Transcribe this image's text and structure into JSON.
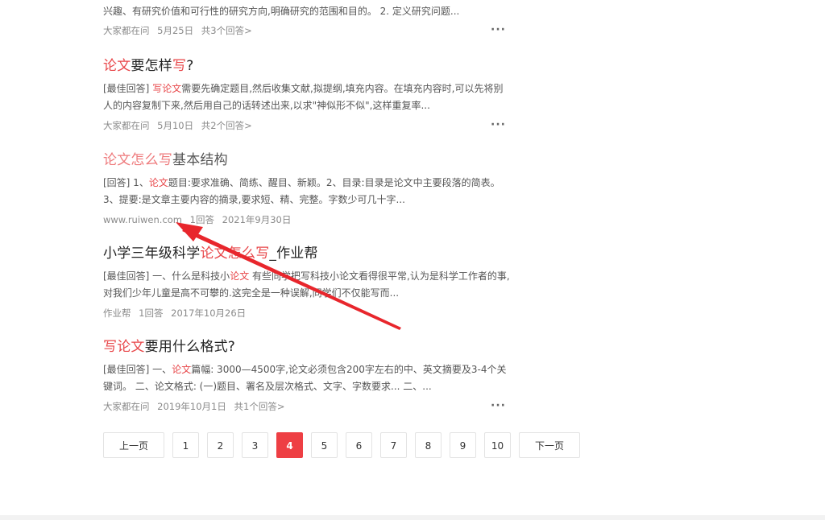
{
  "results": [
    {
      "title_parts": [],
      "snippet_parts": [
        {
          "t": "兴趣、有研究价值和可行性的研究方向,明确研究的范围和目的。 2. 定义研究问题..."
        }
      ],
      "meta": [
        "大家都在问",
        "5月25日",
        "共3个回答>"
      ],
      "more": "···"
    },
    {
      "title_parts": [
        {
          "t": "论文",
          "hl": true
        },
        {
          "t": "要怎样"
        },
        {
          "t": "写",
          "hl": true
        },
        {
          "t": "?"
        }
      ],
      "snippet_parts": [
        {
          "t": "[最佳回答] "
        },
        {
          "t": "写论文",
          "hl": true
        },
        {
          "t": "需要先确定题目,然后收集文献,拟提纲,填充内容。在填充内容时,可以先将别人的内容复制下来,然后用自己的话转述出来,以求\"神似形不似\",这样重复率..."
        }
      ],
      "meta": [
        "大家都在问",
        "5月10日",
        "共2个回答>"
      ],
      "more": "···"
    },
    {
      "title_parts": [
        {
          "t": "论文怎么写",
          "hl": true
        },
        {
          "t": "基本结构"
        }
      ],
      "snippet_parts": [
        {
          "t": "[回答] 1、"
        },
        {
          "t": "论文",
          "hl": true
        },
        {
          "t": "题目:要求准确、简练、醒目、新颖。2、目录:目录是论文中主要段落的简表。3、提要:是文章主要内容的摘录,要求短、精、完整。字数少可几十字..."
        }
      ],
      "meta": [
        "www.ruiwen.com",
        "1回答",
        "2021年9月30日"
      ],
      "more": ""
    },
    {
      "title_parts": [
        {
          "t": "小学三年级科学"
        },
        {
          "t": "论文怎么写",
          "hl": true
        },
        {
          "t": "_作业帮"
        }
      ],
      "snippet_parts": [
        {
          "t": "[最佳回答] 一、什么是科技小"
        },
        {
          "t": "论文",
          "hl": true
        },
        {
          "t": " 有些同学把写科技小论文看得很平常,认为是科学工作者的事,对我们少年儿童是高不可攀的.这完全是一种误解,同学们不仅能写而..."
        }
      ],
      "meta": [
        "作业帮",
        "1回答",
        "2017年10月26日"
      ],
      "more": ""
    },
    {
      "title_parts": [
        {
          "t": "写论文",
          "hl": true
        },
        {
          "t": "要用什么格式?"
        }
      ],
      "snippet_parts": [
        {
          "t": "[最佳回答] 一、"
        },
        {
          "t": "论文",
          "hl": true
        },
        {
          "t": "篇幅: 3000—4500字,论文必须包含200字左右的中、英文摘要及3-4个关键词。 二、论文格式: (一)题目、署名及层次格式、文字、字数要求... 二、..."
        }
      ],
      "meta": [
        "大家都在问",
        "2019年10月1日",
        "共1个回答>"
      ],
      "more": "···"
    }
  ],
  "pagination": {
    "prev": "上一页",
    "pages": [
      "1",
      "2",
      "3",
      "4",
      "5",
      "6",
      "7",
      "8",
      "9",
      "10"
    ],
    "current": "4",
    "next": "下一页"
  },
  "colors": {
    "highlight": "#e8474a",
    "active_page": "#ee3f44",
    "annotation_arrow": "#e8262c"
  }
}
